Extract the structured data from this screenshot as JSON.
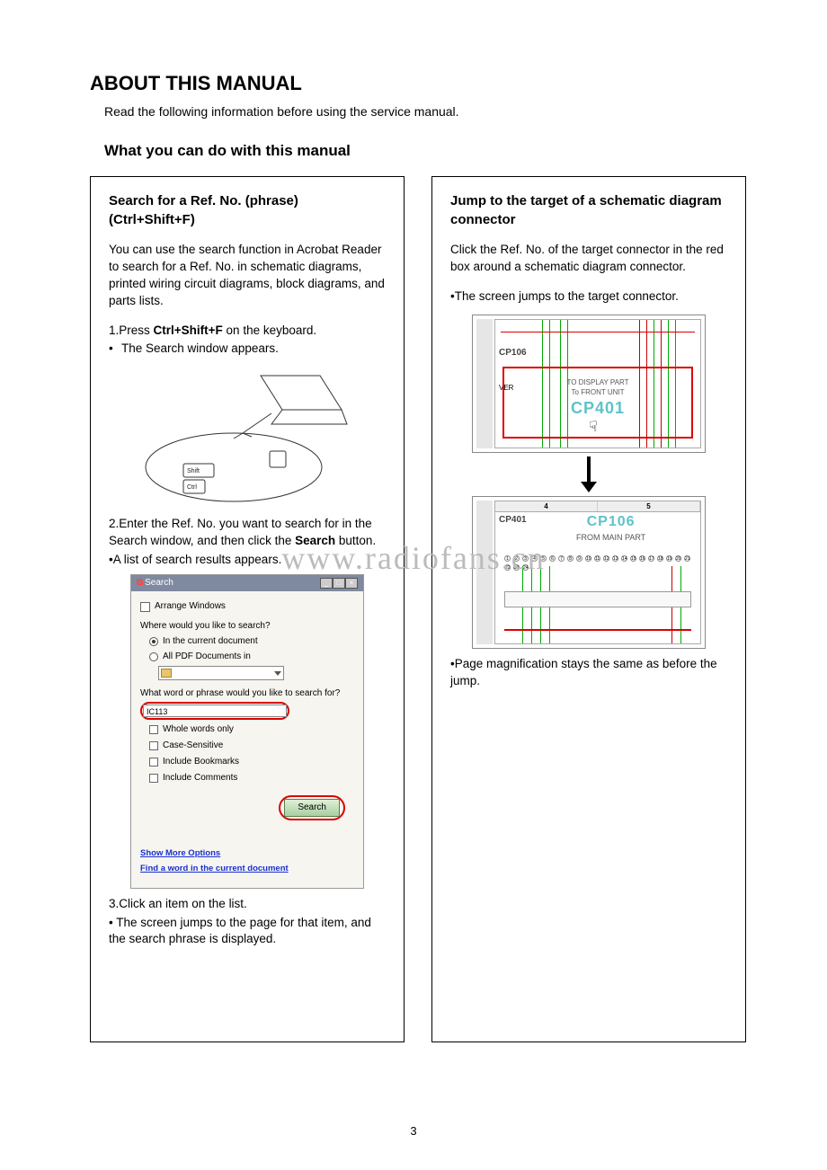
{
  "heading": "ABOUT THIS MANUAL",
  "intro_text": "Read the following information before using the service manual.",
  "subheading": "What you can do with this manual",
  "watermark": "www.radiofans.cn",
  "page_number": "3",
  "left_panel": {
    "title": "Search for a Ref. No. (phrase) (Ctrl+Shift+F)",
    "description": "You can use the search function in Acrobat Reader to search for a Ref. No. in schematic diagrams, printed wiring circuit diagrams, block diagrams, and parts lists.",
    "step1_pre": "1.Press ",
    "step1_bold": "Ctrl+Shift+F",
    "step1_post": " on the keyboard.",
    "bullet1": "The Search window appears.",
    "keyboard_labels": {
      "shift": "Shift",
      "ctrl": "Ctrl"
    },
    "step2_pre": "2.Enter the Ref. No. you want to search for in the Search window, and then click the ",
    "step2_bold": "Search",
    "step2_post": " button.",
    "note2": "•A list of search results appears.",
    "search_window": {
      "title": "Search",
      "arrange": "Arrange Windows",
      "where_label": "Where would you like to search?",
      "opt_current": "In the current document",
      "opt_all": "All PDF Documents in",
      "phrase_label": "What word or phrase would you like to search for?",
      "input_value": "IC113",
      "whole_words": "Whole words only",
      "case_sensitive": "Case-Sensitive",
      "include_bookmarks": "Include Bookmarks",
      "include_comments": "Include Comments",
      "search_btn": "Search",
      "show_more": "Show More Options",
      "find_in_doc": "Find a word in the current document"
    },
    "step3": "3.Click an item on the list.",
    "bullet3": "• The screen jumps to the page for that item, and the search phrase is displayed."
  },
  "right_panel": {
    "title": "Jump to the target of a schematic diagram connector",
    "description": "Click the Ref. No. of the target connector in the red box around a schematic diagram connector.",
    "note1": "•The screen jumps to the target connector.",
    "schematic1": {
      "left_label_top": "CP106",
      "left_label_side": "VER",
      "to_line1": "TO DISPLAY PART",
      "to_line2": "To FRONT UNIT",
      "link": "CP401"
    },
    "schematic2": {
      "ruler": [
        "4",
        "5"
      ],
      "left_label": "CP401",
      "link": "CP106",
      "from_text": "FROM MAIN PART"
    },
    "note2": "•Page magnification stays the same as before the jump."
  }
}
